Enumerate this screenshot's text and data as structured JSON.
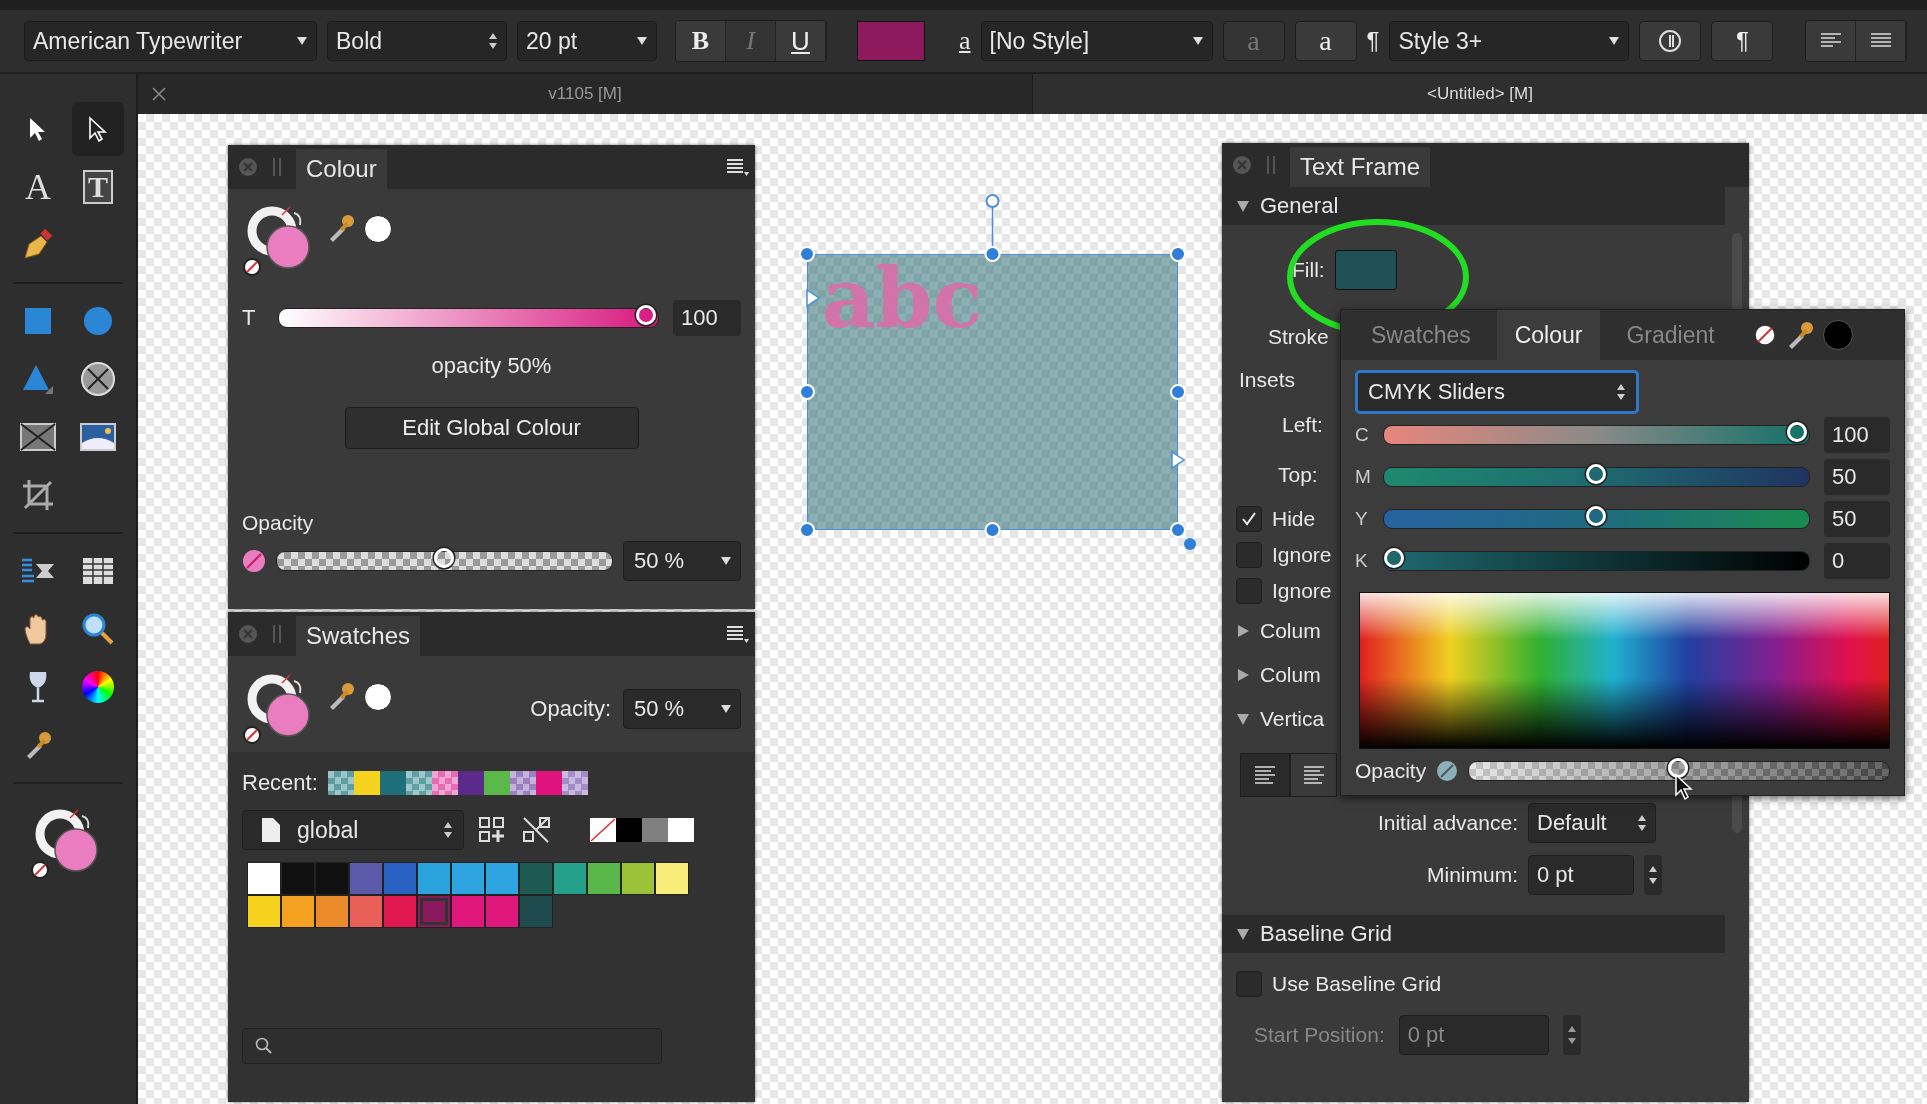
{
  "toolbar": {
    "font_family": "American Typewriter",
    "font_weight": "Bold",
    "font_size": "20 pt",
    "format_buttons": [
      {
        "label": "B",
        "kind": "bold",
        "disabled": false
      },
      {
        "label": "I",
        "kind": "italic",
        "disabled": true
      },
      {
        "label": "U",
        "kind": "underline",
        "disabled": false
      }
    ],
    "char_style_glyph": "a",
    "char_style": "[No Style]",
    "char_buttons": [
      {
        "label": "a",
        "disabled": true
      },
      {
        "label": "a",
        "disabled": false
      }
    ],
    "para_glyph": "¶",
    "para_style": "Style 3+",
    "para_button": "¶"
  },
  "document_tabs": [
    {
      "title": "v1105  [M]",
      "selected": false
    },
    {
      "title": "<Untitled> [M]",
      "selected": true
    }
  ],
  "tool_groups": [
    [
      {
        "kind": "pointer",
        "selected": false
      },
      {
        "kind": "node",
        "selected": true
      },
      {
        "kind": "glyph",
        "glyph": "A",
        "selected": false
      },
      {
        "kind": "boxed-glyph",
        "glyph": "T",
        "selected": false
      },
      {
        "kind": "pen",
        "selected": false
      }
    ],
    [
      {
        "kind": "rectangle",
        "selected": false
      },
      {
        "kind": "ellipse",
        "selected": false
      },
      {
        "kind": "triangle",
        "selected": false
      },
      {
        "kind": "cross-circle",
        "selected": false
      },
      {
        "kind": "picture-frame",
        "selected": false
      },
      {
        "kind": "image",
        "selected": false
      },
      {
        "kind": "crop",
        "selected": false
      }
    ],
    [
      {
        "kind": "table-text",
        "selected": false
      },
      {
        "kind": "table",
        "selected": false
      },
      {
        "kind": "hand",
        "selected": false
      },
      {
        "kind": "zoom",
        "selected": false
      },
      {
        "kind": "wine-glass",
        "selected": false
      },
      {
        "kind": "colour-wheel",
        "selected": false
      },
      {
        "kind": "eyedropper",
        "selected": false
      }
    ]
  ],
  "colour_panel": {
    "title": "Colour",
    "tint_label": "T",
    "tint": {
      "level": 1,
      "value": "100"
    },
    "note": "opacity 50%",
    "button": "Edit Global Colour",
    "opacity_label": "Opacity",
    "opacity": {
      "level": 0.5,
      "value": "50 %"
    }
  },
  "swatches_panel": {
    "title": "Swatches",
    "opacity_label": "Opacity:",
    "opacity_value": "50 %",
    "recent_label": "Recent:",
    "recent": [
      {
        "color": "#5d9ea2",
        "kind": "checker"
      },
      {
        "color": "#f5d21e",
        "kind": "solid"
      },
      {
        "color": "#1f6f7a",
        "kind": "solid"
      },
      {
        "color": "#5fa0a4",
        "kind": "checker"
      },
      {
        "color": "#e86cb5",
        "kind": "checker"
      },
      {
        "color": "#5b2a8a",
        "kind": "solid"
      },
      {
        "color": "#5cb84a",
        "kind": "solid"
      },
      {
        "color": "#9c7fc0",
        "kind": "checker"
      },
      {
        "color": "#e0137e",
        "kind": "solid"
      },
      {
        "color": "#a48cc8",
        "kind": "checker"
      }
    ],
    "palette": "global",
    "quick": [
      {
        "color": "#ffffff",
        "kind": "none"
      },
      {
        "color": "#000000",
        "kind": "solid"
      },
      {
        "color": "#808080",
        "kind": "solid"
      },
      {
        "color": "#ffffff",
        "kind": "solid"
      }
    ],
    "swatches": [
      {
        "color": "#ffffff",
        "selected": false
      },
      {
        "color": "#111111",
        "selected": false
      },
      {
        "color": "#111111",
        "selected": false
      },
      {
        "color": "#5a5aa8",
        "selected": false
      },
      {
        "color": "#2a62c4",
        "selected": false
      },
      {
        "color": "#2ba3dc",
        "selected": false
      },
      {
        "color": "#2ea4e0",
        "selected": false
      },
      {
        "color": "#2ea4e0",
        "selected": false
      },
      {
        "color": "#1c5a52",
        "selected": false
      },
      {
        "color": "#25a08a",
        "selected": false
      },
      {
        "color": "#5ab84a",
        "selected": false
      },
      {
        "color": "#9cc23a",
        "selected": false
      },
      {
        "color": "#f8ec7a",
        "selected": false
      },
      {
        "color": "#f5d21e",
        "selected": false
      },
      {
        "color": "#f4a020",
        "selected": false
      },
      {
        "color": "#ea8a2a",
        "selected": false
      },
      {
        "color": "#e86058",
        "selected": false
      },
      {
        "color": "#e0184f",
        "selected": false
      },
      {
        "color": "#8b1a5c",
        "selected": true
      },
      {
        "color": "#e0187e",
        "selected": false
      },
      {
        "color": "#e0187e",
        "selected": false
      },
      {
        "color": "#1f4a4e",
        "selected": false
      }
    ]
  },
  "text_frame": {
    "text": "abc",
    "selected": true
  },
  "text_frame_panel": {
    "title": "Text Frame",
    "general": {
      "label": "General",
      "expanded": true,
      "fill_label": "Fill:",
      "stroke_label": "Stroke",
      "insets_label": "Insets",
      "left_label": "Left:",
      "top_label": "Top:",
      "checkboxes": [
        {
          "label": "Hide",
          "checked": true
        },
        {
          "label": "Ignore",
          "checked": false
        },
        {
          "label": "Ignore",
          "checked": false
        }
      ]
    },
    "collapsed_sections": [
      {
        "label": "Colum",
        "expanded": false
      },
      {
        "label": "Colum",
        "expanded": false
      }
    ],
    "vertical": {
      "label": "Vertica",
      "expanded": true,
      "align_buttons": [
        {
          "selected": true
        },
        {
          "selected": false
        }
      ],
      "initial_advance_label": "Initial advance:",
      "initial_advance": "Default",
      "minimum_label": "Minimum:",
      "minimum": "0 pt"
    },
    "baseline": {
      "label": "Baseline Grid",
      "expanded": true,
      "use_label": "Use Baseline Grid",
      "use_checked": false,
      "start_label": "Start Position:",
      "start_value": "0 pt",
      "start_disabled": true
    }
  },
  "colour_popover": {
    "tabs": [
      {
        "label": "Swatches",
        "selected": false
      },
      {
        "label": "Colour",
        "selected": true
      },
      {
        "label": "Gradient",
        "selected": false
      }
    ],
    "mode": "CMYK Sliders",
    "sliders": [
      {
        "channel": "C",
        "level": 1,
        "value": "100"
      },
      {
        "channel": "M",
        "level": 0.5,
        "value": "50"
      },
      {
        "channel": "Y",
        "level": 0.5,
        "value": "50"
      },
      {
        "channel": "K",
        "level": 0,
        "value": "0"
      }
    ],
    "opacity_label": "Opacity",
    "opacity": {
      "level": 0.5
    }
  }
}
